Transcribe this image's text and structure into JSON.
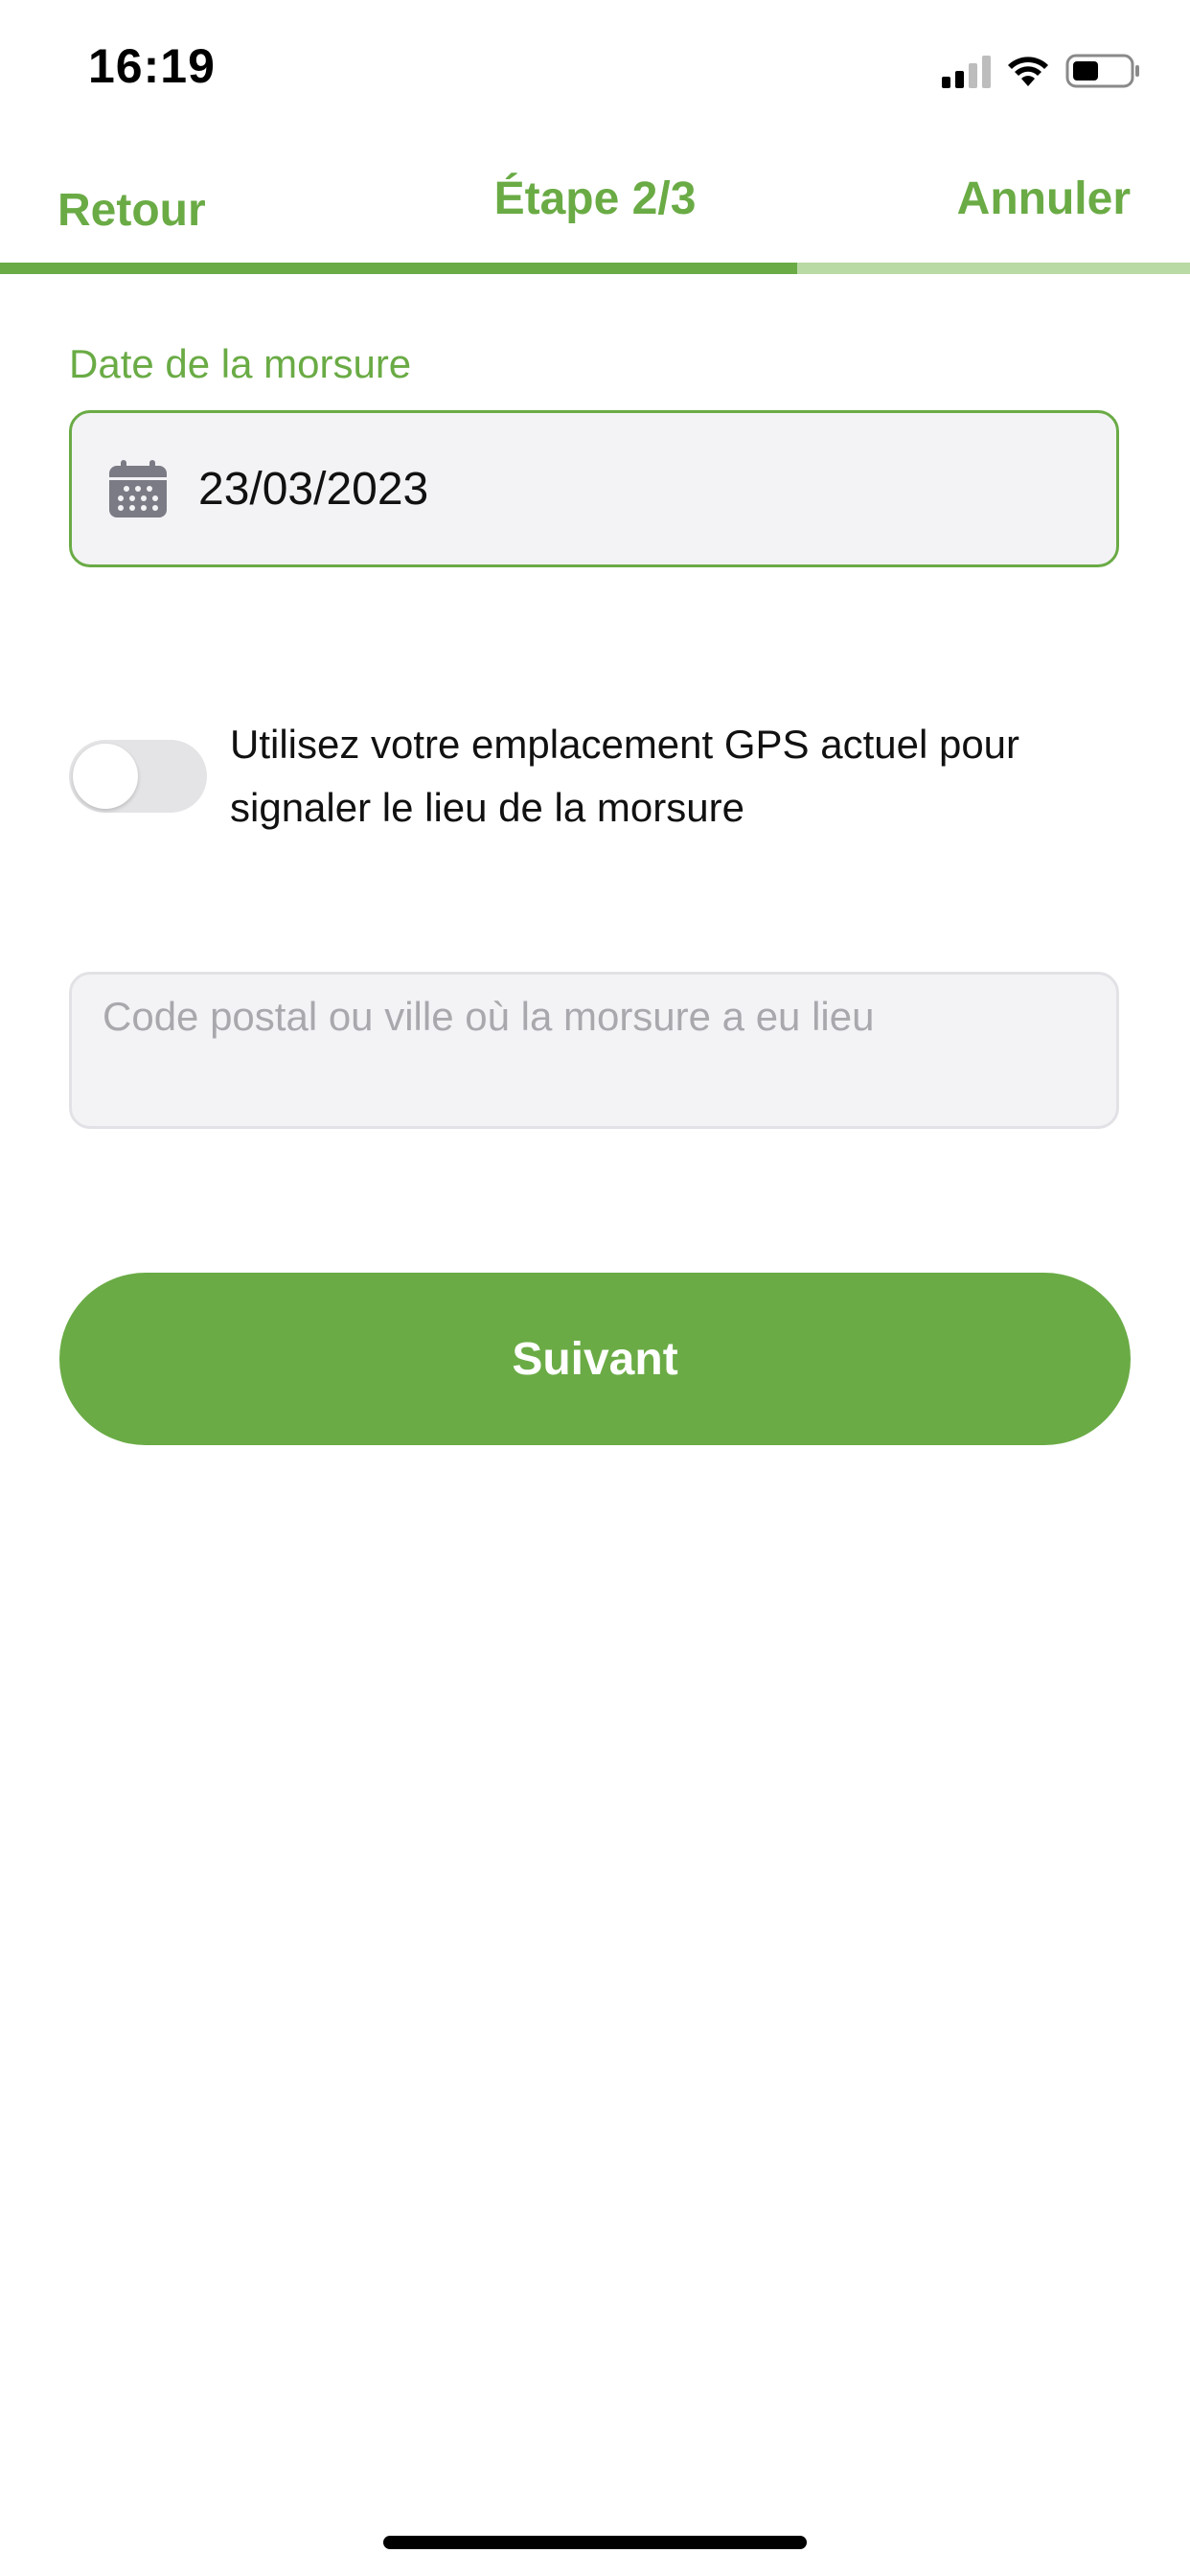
{
  "status_bar": {
    "time": "16:19",
    "icons": [
      "cellular-signal-icon",
      "wifi-icon",
      "battery-icon"
    ]
  },
  "header": {
    "back_label": "Retour",
    "title": "Étape 2/3",
    "cancel_label": "Annuler",
    "step_progress": 0.67
  },
  "date_field": {
    "label": "Date de la morsure",
    "value": "23/03/2023",
    "icon": "calendar-icon"
  },
  "gps_toggle": {
    "label": "Utilisez votre emplacement GPS actuel pour signaler le lieu de la morsure",
    "enabled": false
  },
  "location_field": {
    "value": "",
    "placeholder": "Code postal ou ville où la morsure a eu lieu"
  },
  "next_button": {
    "label": "Suivant"
  },
  "colors": {
    "accent": "#6aab45",
    "accent_light": "#b9d9a5",
    "field_bg": "#f3f3f6",
    "placeholder": "#a9a9ad"
  }
}
